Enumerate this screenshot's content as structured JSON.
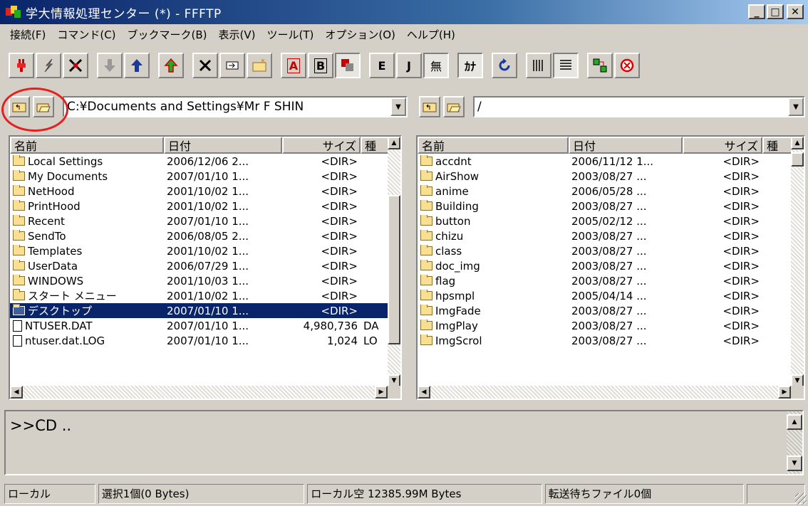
{
  "window": {
    "title": "学大情報処理センター (*) - FFFTP",
    "minimize": "_",
    "maximize": "□",
    "close": "✕"
  },
  "menu": [
    "接続(F)",
    "コマンド(C)",
    "ブックマーク(B)",
    "表示(V)",
    "ツール(T)",
    "オプション(O)",
    "ヘルプ(H)"
  ],
  "toolbar": {
    "icons": [
      "connect-icon",
      "quick-connect-icon",
      "disconnect-icon",
      "download-icon",
      "upload-icon",
      "mirror-upload-icon",
      "delete-icon",
      "rename-icon",
      "mkdir-icon",
      "ascii-mode-icon",
      "binary-mode-icon",
      "auto-mode-icon",
      "eucjp-icon",
      "jis-icon",
      "no-convert-icon",
      "kana-convert-icon",
      "refresh-icon",
      "list-view-icon",
      "detail-view-icon",
      "sync-browse-icon",
      "abort-icon"
    ],
    "labels": {
      "ascii": "A",
      "binary": "B",
      "euc": "E",
      "jis": "J",
      "noconv": "無",
      "kana": "ｶﾅ"
    }
  },
  "local": {
    "path": "C:¥Documents and Settings¥Mr F SHIN",
    "headers": {
      "name": "名前",
      "date": "日付",
      "size": "サイズ",
      "type": "種"
    },
    "rows": [
      {
        "name": "Local Settings",
        "date": "2006/12/06 2...",
        "size": "<DIR>",
        "type": "",
        "kind": "folder"
      },
      {
        "name": "My Documents",
        "date": "2007/01/10 1...",
        "size": "<DIR>",
        "type": "",
        "kind": "folder"
      },
      {
        "name": "NetHood",
        "date": "2001/10/02 1...",
        "size": "<DIR>",
        "type": "",
        "kind": "folder"
      },
      {
        "name": "PrintHood",
        "date": "2001/10/02 1...",
        "size": "<DIR>",
        "type": "",
        "kind": "folder"
      },
      {
        "name": "Recent",
        "date": "2007/01/10 1...",
        "size": "<DIR>",
        "type": "",
        "kind": "folder"
      },
      {
        "name": "SendTo",
        "date": "2006/08/05 2...",
        "size": "<DIR>",
        "type": "",
        "kind": "folder"
      },
      {
        "name": "Templates",
        "date": "2001/10/02 1...",
        "size": "<DIR>",
        "type": "",
        "kind": "folder"
      },
      {
        "name": "UserData",
        "date": "2006/07/29 1...",
        "size": "<DIR>",
        "type": "",
        "kind": "folder"
      },
      {
        "name": "WINDOWS",
        "date": "2001/10/03 1...",
        "size": "<DIR>",
        "type": "",
        "kind": "folder"
      },
      {
        "name": "スタート メニュー",
        "date": "2001/10/02 1...",
        "size": "<DIR>",
        "type": "",
        "kind": "folder"
      },
      {
        "name": "デスクトップ",
        "date": "2007/01/10 1...",
        "size": "<DIR>",
        "type": "",
        "kind": "folder",
        "selected": true
      },
      {
        "name": "NTUSER.DAT",
        "date": "2007/01/10 1...",
        "size": "4,980,736",
        "type": "DA",
        "kind": "file"
      },
      {
        "name": "ntuser.dat.LOG",
        "date": "2007/01/10 1...",
        "size": "1,024",
        "type": "LO",
        "kind": "file"
      }
    ]
  },
  "remote": {
    "path": "/",
    "headers": {
      "name": "名前",
      "date": "日付",
      "size": "サイズ",
      "type": "種"
    },
    "rows": [
      {
        "name": "accdnt",
        "date": "2006/11/12 1...",
        "size": "<DIR>",
        "kind": "folder"
      },
      {
        "name": "AirShow",
        "date": "2003/08/27   ...",
        "size": "<DIR>",
        "kind": "folder"
      },
      {
        "name": "anime",
        "date": "2006/05/28   ...",
        "size": "<DIR>",
        "kind": "folder"
      },
      {
        "name": "Building",
        "date": "2003/08/27   ...",
        "size": "<DIR>",
        "kind": "folder"
      },
      {
        "name": "button",
        "date": "2005/02/12   ...",
        "size": "<DIR>",
        "kind": "folder"
      },
      {
        "name": "chizu",
        "date": "2003/08/27   ...",
        "size": "<DIR>",
        "kind": "folder"
      },
      {
        "name": "class",
        "date": "2003/08/27   ...",
        "size": "<DIR>",
        "kind": "folder"
      },
      {
        "name": "doc_img",
        "date": "2003/08/27   ...",
        "size": "<DIR>",
        "kind": "folder"
      },
      {
        "name": "flag",
        "date": "2003/08/27   ...",
        "size": "<DIR>",
        "kind": "folder"
      },
      {
        "name": "hpsmpl",
        "date": "2005/04/14   ...",
        "size": "<DIR>",
        "kind": "folder"
      },
      {
        "name": "ImgFade",
        "date": "2003/08/27   ...",
        "size": "<DIR>",
        "kind": "folder"
      },
      {
        "name": "ImgPlay",
        "date": "2003/08/27   ...",
        "size": "<DIR>",
        "kind": "folder"
      },
      {
        "name": "ImgScrol",
        "date": "2003/08/27   ...",
        "size": "<DIR>",
        "kind": "folder"
      }
    ]
  },
  "log": {
    "text": ">>CD .."
  },
  "status": {
    "side": "ローカル",
    "selection": "選択1個(0 Bytes)",
    "free": "ローカル空 12385.99M Bytes",
    "queue": "転送待ちファイル0個",
    "extra": ""
  },
  "colors": {
    "selection": "#0a246a",
    "highlight_circle": "#e4201e",
    "face": "#d4d0c8"
  }
}
